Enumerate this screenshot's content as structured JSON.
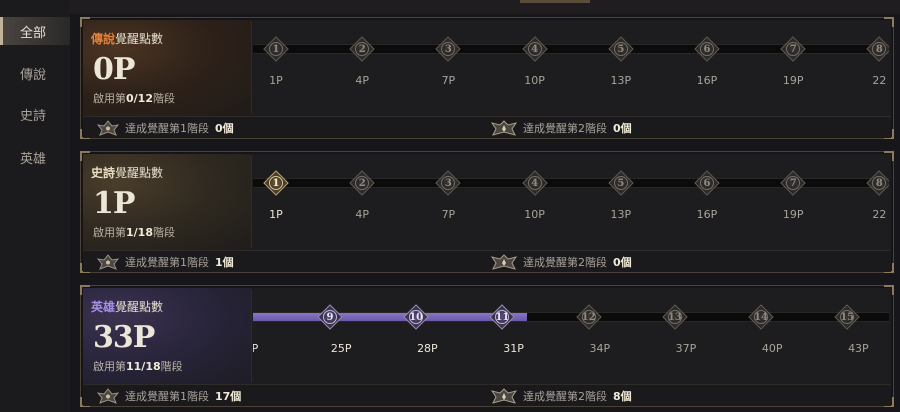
{
  "sidebar": {
    "items": [
      {
        "label": "全部",
        "active": true
      },
      {
        "label": "傳說",
        "active": false
      },
      {
        "label": "史詩",
        "active": false
      },
      {
        "label": "英雄",
        "active": false
      }
    ]
  },
  "panels": [
    {
      "tier": "傳說",
      "title_suffix": "覺醒點數",
      "points": "0P",
      "stage_prefix": "啟用第",
      "stage_value": "0/12",
      "stage_suffix": "階段",
      "nodes": [
        "1",
        "2",
        "3",
        "4",
        "5",
        "6",
        "7",
        "8"
      ],
      "node_points": [
        "1P",
        "4P",
        "7P",
        "10P",
        "13P",
        "16P",
        "19P",
        "22"
      ],
      "completed_nodes": 0,
      "reward1_label": "達成覺醒第1階段",
      "reward1_count": "0個",
      "reward2_label": "達成覺醒第2階段",
      "reward2_count": "0個"
    },
    {
      "tier": "史詩",
      "title_suffix": "覺醒點數",
      "points": "1P",
      "stage_prefix": "啟用第",
      "stage_value": "1/18",
      "stage_suffix": "階段",
      "nodes": [
        "1",
        "2",
        "3",
        "4",
        "5",
        "6",
        "7",
        "8"
      ],
      "node_points": [
        "1P",
        "4P",
        "7P",
        "10P",
        "13P",
        "16P",
        "19P",
        "22"
      ],
      "completed_nodes": 1,
      "reward1_label": "達成覺醒第1階段",
      "reward1_count": "1個",
      "reward2_label": "達成覺醒第2階段",
      "reward2_count": "0個"
    },
    {
      "tier": "英雄",
      "title_suffix": "覺醒點數",
      "points": "33P",
      "stage_prefix": "啟用第",
      "stage_value": "11/18",
      "stage_suffix": "階段",
      "nodes": [
        "9",
        "10",
        "11",
        "12",
        "13",
        "14",
        "15"
      ],
      "node_points": [
        "P",
        "25P",
        "28P",
        "31P",
        "34P",
        "37P",
        "40P",
        "43P"
      ],
      "completed_nodes": 3,
      "reward1_label": "達成覺醒第1階段",
      "reward1_count": "17個",
      "reward2_label": "達成覺醒第2階段",
      "reward2_count": "8個"
    }
  ],
  "colors": {
    "legendary": "#e0803a",
    "epic": "#e8dcc0",
    "heroic": "#a88ee8",
    "progress_fill": "#7a66b8"
  },
  "icons": {
    "reward1": "awakening-emblem-icon",
    "reward2": "awakening-crest-icon",
    "node": "rune-node-icon"
  }
}
